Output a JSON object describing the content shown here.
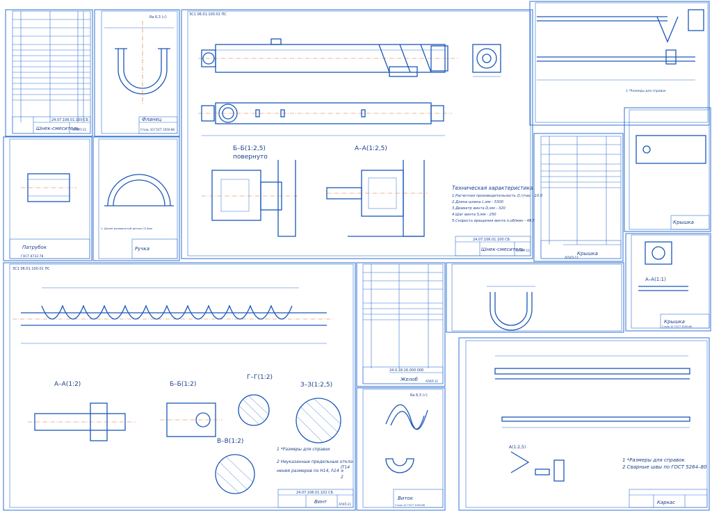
{
  "sheets": {
    "spec_auger_mixer": {
      "code": "24.07.106.01.100 СБ",
      "title": "Шнек-смеситель",
      "group": "АПХП-11"
    },
    "flange": {
      "title": "Фланец",
      "material": "Сталь 10 ГОСТ 1050-88",
      "roughness": "Ra 6,3 (√)"
    },
    "main_assembly": {
      "stamp": "ЗС1 06.01.100.01 ПС",
      "title": "Шнек-смеситель",
      "code": "24.07.106.01.100 СБ",
      "group": "АПХП-11",
      "section_bb": "Б–Б(1:2,5)",
      "section_bb_note": "повернуто",
      "section_aa": "А–А(1:2,5)"
    },
    "tech": {
      "title": "Техническая характеристика",
      "lines": [
        "1.Расчетная производительность Q,т/час - 10,9",
        "2.Длина шнека L,мм - 5300",
        "3.Диаметр винта D,мм - 320",
        "4.Шаг винта S,мм - 250",
        "5.Скорость вращения винта n,об/мин - 48,5"
      ]
    },
    "frame_right": {
      "note": "1.*Размеры для справок"
    },
    "cover_spec": {
      "title": "Крышка",
      "group": "АПХП-11"
    },
    "cover": {
      "title": "Крышка",
      "material": "Сталь 10 ГОСТ 1050-88",
      "section": "А–А(1:1)"
    },
    "pipe": {
      "title": "Патрубок",
      "standard": "ГОСТ 8732-78"
    },
    "handle": {
      "title": "Ручка",
      "note": "1. Длина развернутой детали 214мм"
    },
    "screw": {
      "stamp": "ЗС1 06.01.100.01 ПС",
      "title": "Винт",
      "code": "24.07.106.01.102 СБ",
      "group": "АПХП-21",
      "sections": [
        "А–А(1:2)",
        "Б–Б(1:2)",
        "Г–Г(1:2)",
        "З–З(1:2,5)",
        "В–В(1:2)"
      ],
      "notes": [
        "1 *Размеры для справок",
        "2 Неуказанные предельные откло-",
        "нения размеров по H14, h14 ±",
        "IT14",
        "2"
      ]
    },
    "trough_spec": {
      "title": "Желоб",
      "code": "24.0.18.16.000.000",
      "group": "АПХП-11"
    },
    "coil": {
      "title": "Виток",
      "material": "Сталь 10 ГОСТ 1050-88",
      "roughness": "Ra 6,3 (√)"
    },
    "carcass": {
      "title": "Каркас",
      "section": "А(1:2,5)",
      "notes": [
        "1 *Размеры для справок",
        "2 Сварные швы по ГОСТ 5264–80"
      ]
    }
  }
}
